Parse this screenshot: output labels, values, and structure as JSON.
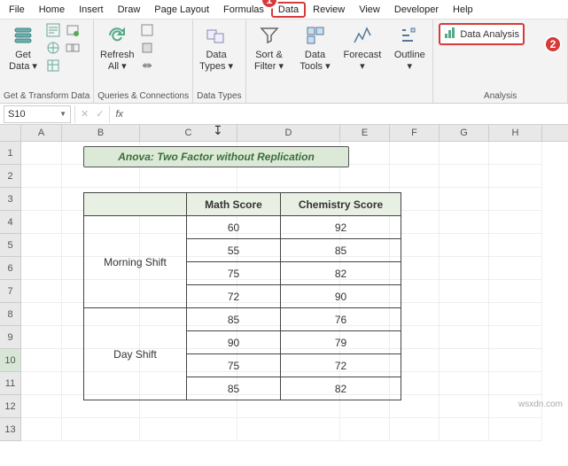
{
  "tabs": {
    "file": "File",
    "home": "Home",
    "insert": "Insert",
    "draw": "Draw",
    "page_layout": "Page Layout",
    "formulas": "Formulas",
    "data": "Data",
    "review": "Review",
    "view": "View",
    "developer": "Developer",
    "help": "Help"
  },
  "badges": {
    "one": "1",
    "two": "2"
  },
  "ribbon": {
    "get_data": "Get\nData ▾",
    "refresh_all": "Refresh\nAll ▾",
    "data_types": "Data\nTypes ▾",
    "sort_filter": "Sort &\nFilter ▾",
    "data_tools": "Data\nTools ▾",
    "forecast": "Forecast\n▾",
    "outline": "Outline\n▾",
    "data_analysis": "Data Analysis",
    "group_get_transform": "Get & Transform Data",
    "group_queries": "Queries & Connections",
    "group_data_types": "Data Types",
    "group_analysis": "Analysis"
  },
  "formula_bar": {
    "namebox": "S10",
    "fx": "fx",
    "value": ""
  },
  "columns": [
    "A",
    "B",
    "C",
    "D",
    "E",
    "F",
    "G",
    "H"
  ],
  "rows": [
    "1",
    "2",
    "3",
    "4",
    "5",
    "6",
    "7",
    "8",
    "9",
    "10",
    "11",
    "12",
    "13"
  ],
  "table": {
    "title": "Anova: Two Factor without Replication",
    "headers": {
      "blank": "",
      "math": "Math Score",
      "chem": "Chemistry Score"
    },
    "shift1_label": "Morning Shift",
    "shift2_label": "Day Shift",
    "shift1": [
      {
        "m": "60",
        "c": "92"
      },
      {
        "m": "55",
        "c": "85"
      },
      {
        "m": "75",
        "c": "82"
      },
      {
        "m": "72",
        "c": "90"
      }
    ],
    "shift2": [
      {
        "m": "85",
        "c": "76"
      },
      {
        "m": "90",
        "c": "79"
      },
      {
        "m": "75",
        "c": "72"
      },
      {
        "m": "85",
        "c": "82"
      }
    ]
  },
  "watermark": "wsxdn.com"
}
